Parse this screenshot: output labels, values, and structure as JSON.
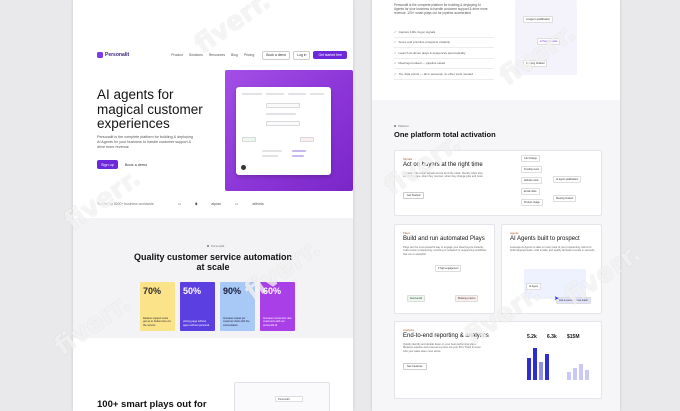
{
  "left_page": {
    "logo": "Personalit",
    "nav": [
      "Product",
      "Solutions",
      "Resources",
      "Blog",
      "Pricing"
    ],
    "book_demo": "Book a demo",
    "login": "Log in",
    "get_started": "Get started free",
    "hero_title": "AI agents for magical customer experiences",
    "hero_sub": "Personalit is the complete platform for building & deploying AI Agents for your business to handle customer support & drive more revenue",
    "sign_up": "Sign up",
    "book_demo_2": "Book a demo",
    "trusted": "Trusted by 8000+ business worldwide",
    "logos": [
      "alpian",
      "allbirds"
    ],
    "s2_tag": "Personalit",
    "s2_title": "Quality customer service automation at scale",
    "cards": [
      {
        "pct": "70%",
        "desc": "Reduce support costs get up to bottom-line cut the service",
        "bg": "#fbe38a",
        "fg": "#2a2a2a"
      },
      {
        "pct": "50%",
        "desc": "pricing page without agent without personal",
        "bg": "#5b3fe0",
        "fg": "#ffffff"
      },
      {
        "pct": "90%",
        "desc": "Increase repeat per customer dock with the conversation",
        "bg": "#a8c9f5",
        "fg": "#1a1a3a"
      },
      {
        "pct": "60%",
        "desc": "Increase conversion rate customers with our personalit AI",
        "bg": "#a93fe6",
        "fg": "#ffffff"
      }
    ],
    "s3_title": "100+ smart plays out for",
    "s3_mini": "Personalit"
  },
  "right_page": {
    "intro": "Personalit is the complete platform for building & deploying AI Agents for your business to handle customer support & drive more revenue. 100+ smart plays out for pipeline accelerated",
    "list": [
      "Capture 100+ buyer signals",
      "Score and prioritize prospects instantly",
      "Launch AI-driven plays & sequences automatically",
      "Meetings booked — pipeline saved",
      "70+ data points — all in personal, no other tools needed"
    ],
    "widget": [
      "AI agent qualification",
      "AI Suggestions",
      "Meeting booked"
    ],
    "tag": "Platform",
    "title": "One platform total activation",
    "panel1": {
      "tag": "Signals",
      "title": "Act on buyers at the right time",
      "desc": "Capture 100+ buyer signals across all of the stack. Identify when they visit key pages, when they mention, when they change jobs and more",
      "btn": "Get Started",
      "nodes": [
        "Job Change",
        "Funding news",
        "Website visits",
        "Email clicks",
        "Product Usage",
        "AI agent qualification",
        "Meeting booked"
      ]
    },
    "panel2": {
      "tag": "Plays",
      "title": "Build and run automated Plays",
      "desc": "Plays are the most powerful way to engage your ideal buyers instantly. Craft custom prospecting, nurturing or research or sequencing workflows that run on autopilot.",
      "nodes": [
        "If high engagement",
        "Send email",
        "Booking a demo"
      ]
    },
    "panel3": {
      "tag": "Agents",
      "title": "AI Agents built to prospect",
      "desc": "Leverage AI Agents to take on every task of your prospecting. Ask AI to build targeted leads, craft emails, and qualify all leads at scale in seconds.",
      "nodes": [
        "AI Agent",
        "Ask a question about leads"
      ]
    },
    "panel4": {
      "tag": "Analytics",
      "title": "End-to-end reporting & analytics",
      "desc": "Quickly identify and double down on your best performing plays. Measure pipeline and revenue to prove out your ROI. Track & score who your sales team most active",
      "btn": "See Features",
      "stats": [
        "5.2k",
        "6.3k",
        "$15M"
      ]
    }
  },
  "watermark": "fiverr"
}
